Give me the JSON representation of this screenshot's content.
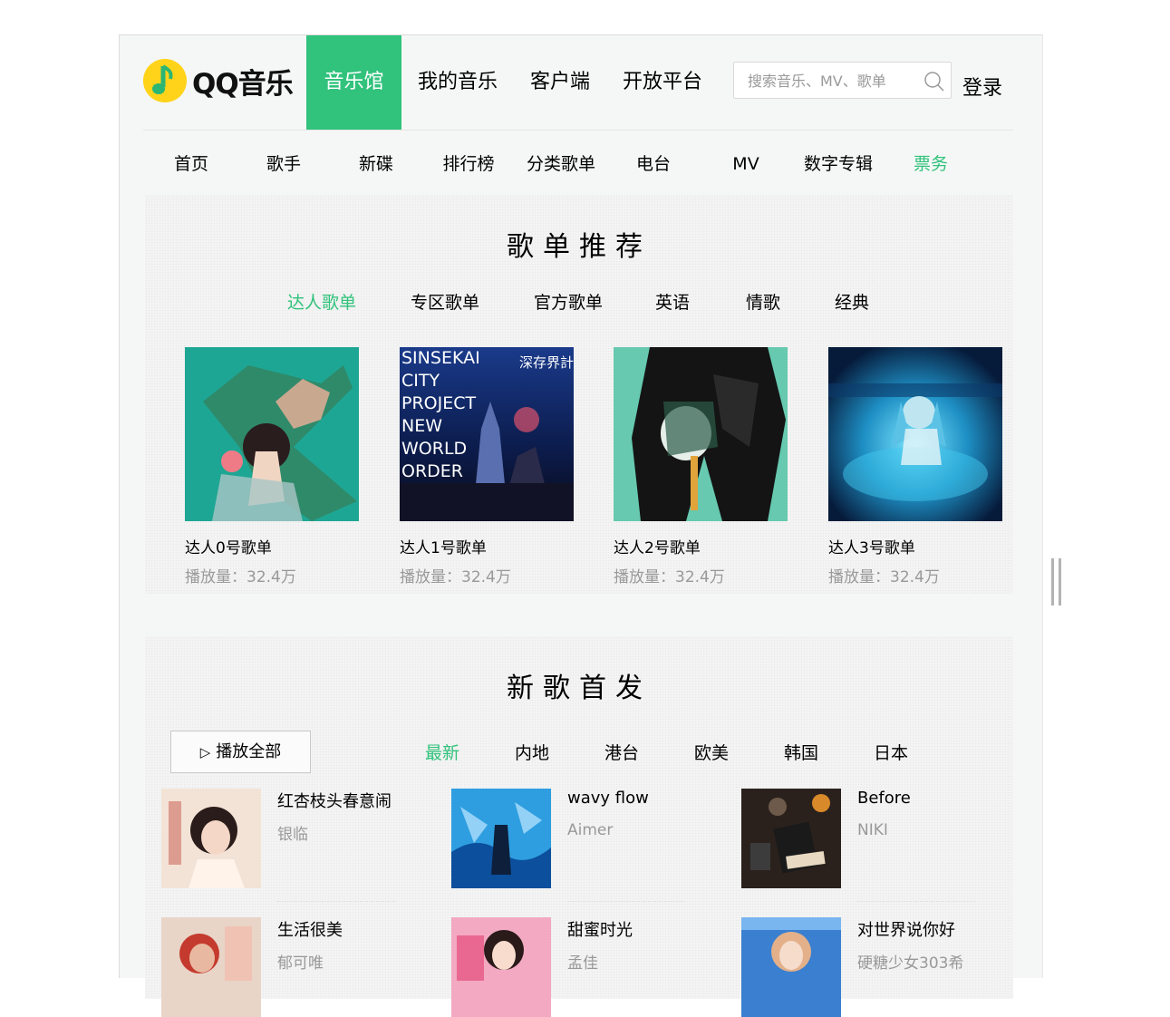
{
  "header": {
    "logo_text": "QQ音乐",
    "nav": [
      "音乐馆",
      "我的音乐",
      "客户端",
      "开放平台"
    ],
    "search_placeholder": "搜索音乐、MV、歌单",
    "login": "登录"
  },
  "subnav": [
    "首页",
    "歌手",
    "新碟",
    "排行榜",
    "分类歌单",
    "电台",
    "MV",
    "数字专辑",
    "票务"
  ],
  "playlist_section": {
    "title": "歌单推荐",
    "tabs": [
      "达人歌单",
      "专区歌单",
      "官方歌单",
      "英语",
      "情歌",
      "经典"
    ],
    "cards": [
      {
        "name": "达人0号歌单",
        "plays": "播放量：32.4万"
      },
      {
        "name": "达人1号歌单",
        "plays": "播放量：32.4万",
        "cover_text": [
          "SINSEKAI",
          "CITY",
          "PROJECT",
          "NEW",
          "WORLD",
          "ORDER"
        ],
        "cover_jp": "深存界計画"
      },
      {
        "name": "达人2号歌单",
        "plays": "播放量：32.4万"
      },
      {
        "name": "达人3号歌单",
        "plays": "播放量：32.4万"
      }
    ]
  },
  "newsong_section": {
    "title": "新歌首发",
    "play_all": "播放全部",
    "tabs": [
      "最新",
      "内地",
      "港台",
      "欧美",
      "韩国",
      "日本"
    ],
    "songs": [
      {
        "title": "红杏枝头春意闹",
        "artist": "银临"
      },
      {
        "title": "wavy flow",
        "artist": "Aimer"
      },
      {
        "title": "Before",
        "artist": "NIKI"
      },
      {
        "title": "生活很美",
        "artist": "郁可唯"
      },
      {
        "title": "甜蜜时光",
        "artist": "孟佳"
      },
      {
        "title": "对世界说你好",
        "artist": "硬糖少女303希"
      }
    ]
  },
  "colors": {
    "accent": "#31c27c",
    "muted": "#999999"
  },
  "icons": {
    "search": "search-icon",
    "play": "play-icon",
    "logo": "qq-music-logo-icon"
  }
}
